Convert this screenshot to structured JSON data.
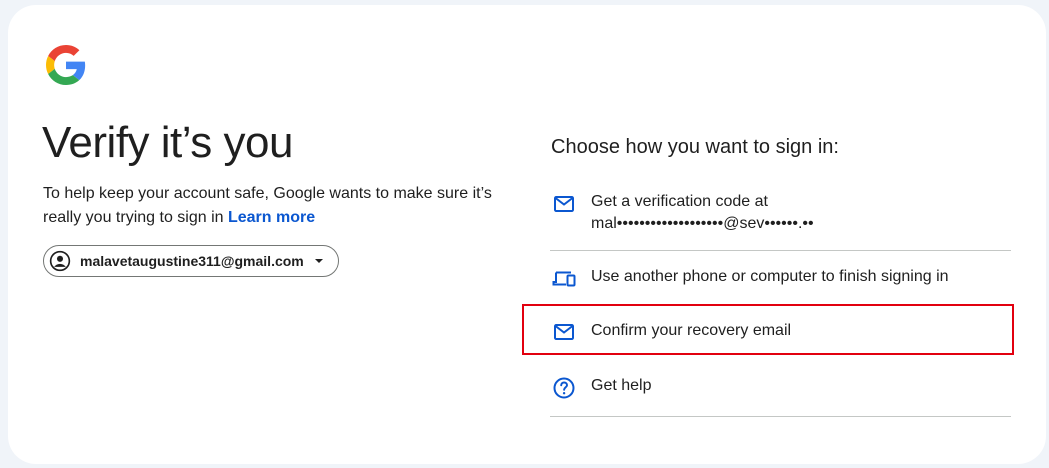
{
  "brand": {
    "logo_icon": "google-g-logo",
    "colors": {
      "blue": "#4285F4",
      "red": "#EA4335",
      "yellow": "#FBBC05",
      "green": "#34A853"
    }
  },
  "page": {
    "title": "Verify it’s you",
    "subtitle": "To help keep your account safe, Google wants to make sure it’s really you trying to sign in",
    "learn_more": "Learn more"
  },
  "account": {
    "email": "malavetaugustine311@gmail.com",
    "avatar_icon": "account-circle-icon",
    "dropdown_icon": "caret-down-icon"
  },
  "signin": {
    "heading": "Choose how you want to sign in:",
    "options": [
      {
        "icon": "mail-icon",
        "line1": "Get a verification code at",
        "line2": "mal•••••••••••••••••••@sev••••••.••"
      },
      {
        "icon": "devices-icon",
        "label": "Use another phone or computer to finish signing in"
      },
      {
        "icon": "mail-icon",
        "label": "Confirm your recovery email"
      },
      {
        "icon": "help-circle-icon",
        "label": "Get help"
      }
    ]
  },
  "accent_color": "#0b57d0",
  "highlight_color": "#e2000f"
}
